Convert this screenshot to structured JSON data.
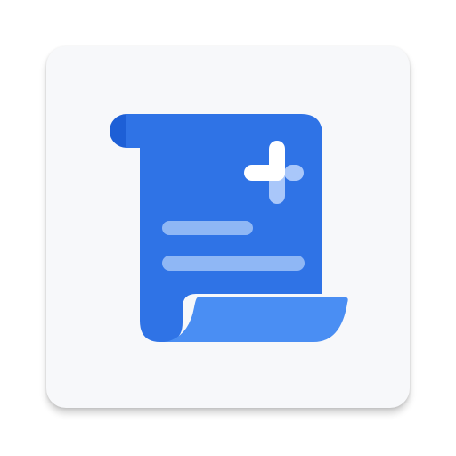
{
  "app_icon": {
    "name": "scroll-document-plus-icon",
    "colors": {
      "tile": "#f7f8fa",
      "scroll_body": "#2f73e6",
      "scroll_roll_top": "#1d5fd6",
      "scroll_roll_bottom": "#4a8ef3",
      "text_lines": "#8fb7f5",
      "plus_solid": "#ffffff",
      "plus_faded": "#a9c7fa"
    }
  }
}
